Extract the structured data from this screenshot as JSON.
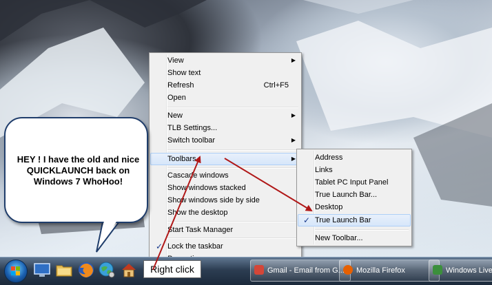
{
  "context_menu": {
    "items": [
      {
        "label": "View",
        "shortcut": "",
        "submenu": true
      },
      {
        "label": "Show text",
        "shortcut": "",
        "submenu": false
      },
      {
        "label": "Refresh",
        "shortcut": "Ctrl+F5",
        "submenu": false
      },
      {
        "label": "Open",
        "shortcut": "",
        "submenu": false
      },
      {
        "label": "New",
        "shortcut": "",
        "submenu": true
      },
      {
        "label": "TLB Settings...",
        "shortcut": "",
        "submenu": false
      },
      {
        "label": "Switch toolbar",
        "shortcut": "",
        "submenu": true
      },
      {
        "label": "Toolbars",
        "shortcut": "",
        "submenu": true
      },
      {
        "label": "Cascade windows",
        "shortcut": "",
        "submenu": false
      },
      {
        "label": "Show windows stacked",
        "shortcut": "",
        "submenu": false
      },
      {
        "label": "Show windows side by side",
        "shortcut": "",
        "submenu": false
      },
      {
        "label": "Show the desktop",
        "shortcut": "",
        "submenu": false
      },
      {
        "label": "Start Task Manager",
        "shortcut": "",
        "submenu": false
      },
      {
        "label": "Lock the taskbar",
        "shortcut": "",
        "submenu": false,
        "checked": true
      },
      {
        "label": "Properties",
        "shortcut": "",
        "submenu": false
      }
    ]
  },
  "toolbars_submenu": {
    "items": [
      {
        "label": "Address"
      },
      {
        "label": "Links"
      },
      {
        "label": "Tablet PC Input Panel"
      },
      {
        "label": "True Launch Bar..."
      },
      {
        "label": "Desktop"
      },
      {
        "label": "True Launch Bar",
        "checked": true
      },
      {
        "label": "New Toolbar..."
      }
    ]
  },
  "bubble": {
    "text": "HEY ! I have the old and nice QUICKLAUNCH back on Windows 7 WhoHoo!"
  },
  "callout": {
    "text": "Right click"
  },
  "taskbar": {
    "buttons": [
      {
        "label": "Gmail - Email from G...",
        "icon": "gmail-icon",
        "color": "#d44638"
      },
      {
        "label": "Mozilla Firefox",
        "icon": "firefox-icon",
        "color": "#e66000"
      },
      {
        "label": "Windows Live I",
        "icon": "windows-live-icon",
        "color": "#3c8f3c"
      }
    ],
    "quicklaunch": [
      "show-desktop-icon",
      "explorer-folder-icon",
      "firefox-icon",
      "internet-icon",
      "home-icon"
    ]
  },
  "colors": {
    "arrow": "#b01818",
    "menu_bg": "#f0f0f0",
    "highlight_border": "#aecff7"
  }
}
